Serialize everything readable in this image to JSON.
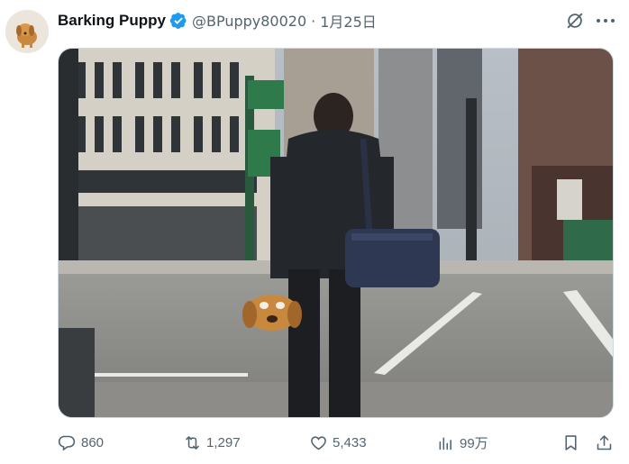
{
  "post": {
    "author": {
      "display_name": "Barking Puppy",
      "handle": "@BPuppy80020",
      "verified": true
    },
    "separator": "·",
    "date": "1月25日",
    "media_description_icon": "photo",
    "stats": {
      "replies": "860",
      "reposts": "1,297",
      "likes": "5,433",
      "views": "99万"
    }
  },
  "icons": {
    "grok": "grok-icon",
    "more": "more-icon",
    "reply": "reply-icon",
    "repost": "repost-icon",
    "like": "heart-icon",
    "views": "views-icon",
    "bookmark": "bookmark-icon",
    "share": "share-icon"
  },
  "colors": {
    "verified_blue": "#1d9bf0",
    "secondary_text": "#536471",
    "primary_text": "#0f1419",
    "border": "#cfd9de"
  }
}
